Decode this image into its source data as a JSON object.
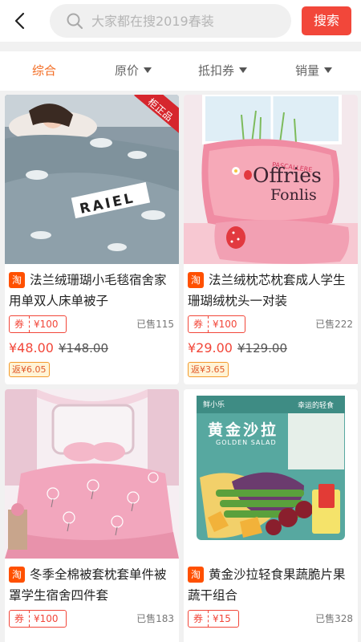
{
  "header": {
    "search_placeholder": "大家都在搜2019春装",
    "search_button": "搜索"
  },
  "sort_tabs": [
    "综合",
    "原价",
    "抵扣券",
    "销量"
  ],
  "products": [
    {
      "source_badge": "淘",
      "title": "法兰绒珊瑚小毛毯宿舍家用单双人床单被子",
      "coupon_tag": "券",
      "coupon_amount": "¥100",
      "sold": "已售115",
      "price": "¥48.00",
      "original_price": "¥148.00",
      "rebate": "返¥6.05",
      "image_text_brand": "RAIEL",
      "image_ribbon": "柜正品"
    },
    {
      "source_badge": "淘",
      "title": "法兰绒枕芯枕套成人学生珊瑚绒枕头一对装",
      "coupon_tag": "券",
      "coupon_amount": "¥100",
      "sold": "已售222",
      "price": "¥29.00",
      "original_price": "¥129.00",
      "rebate": "返¥3.65",
      "image_text_top": "PASCALLERE",
      "image_text_main": "Offries",
      "image_text_sub": "Fonlis"
    },
    {
      "source_badge": "淘",
      "title": "冬季全棉被套枕套单件被罩学生宿舍四件套",
      "coupon_tag": "券",
      "coupon_amount": "¥100",
      "sold": "已售183"
    },
    {
      "source_badge": "淘",
      "title": "黄金沙拉轻食果蔬脆片果蔬干组合",
      "coupon_tag": "券",
      "coupon_amount": "¥15",
      "sold": "已售328",
      "image_text_brand": "鲜小乐",
      "image_text_main": "黄金沙拉",
      "image_text_sub": "GOLDEN SALAD",
      "image_text_side": "幸运的轻食"
    }
  ],
  "colors": {
    "accent": "#f2473a",
    "active_tab": "#f36a1f",
    "taobao": "#ff5000"
  }
}
